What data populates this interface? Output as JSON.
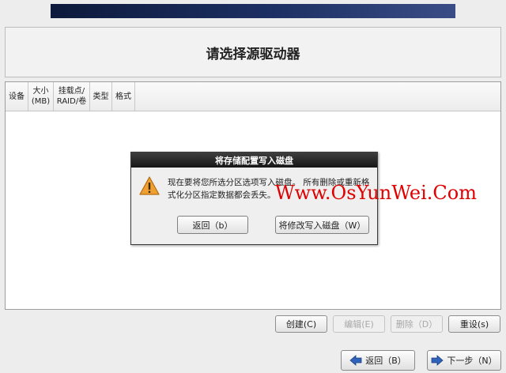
{
  "title": "请选择源驱动器",
  "table": {
    "columns": [
      {
        "label": "设备"
      },
      {
        "label": "大小\n(MB)"
      },
      {
        "label": "挂载点/\nRAID/卷"
      },
      {
        "label": "类型"
      },
      {
        "label": "格式"
      }
    ],
    "rows": []
  },
  "actions": {
    "create": "创建(C)",
    "edit": "编辑(E)",
    "delete": "删除（D）",
    "reset": "重设(s)"
  },
  "nav": {
    "back": "返回（B）",
    "next": "下一步（N）"
  },
  "dialog": {
    "title": "将存储配置写入磁盘",
    "message_line1": "现在要将您所选分区选项写入磁盘。 所有删除或重新格",
    "message_line2": "式化分区指定数据都会丢失。",
    "back_button": "返回（b）",
    "write_button": "将修改写入磁盘（W）"
  },
  "watermark": "Www.OsYunWei.Com",
  "colors": {
    "banner": "#1d3063",
    "dialog_title_bg": "#1e1e1e",
    "warning": "#f0a030",
    "watermark": "#e00000"
  }
}
